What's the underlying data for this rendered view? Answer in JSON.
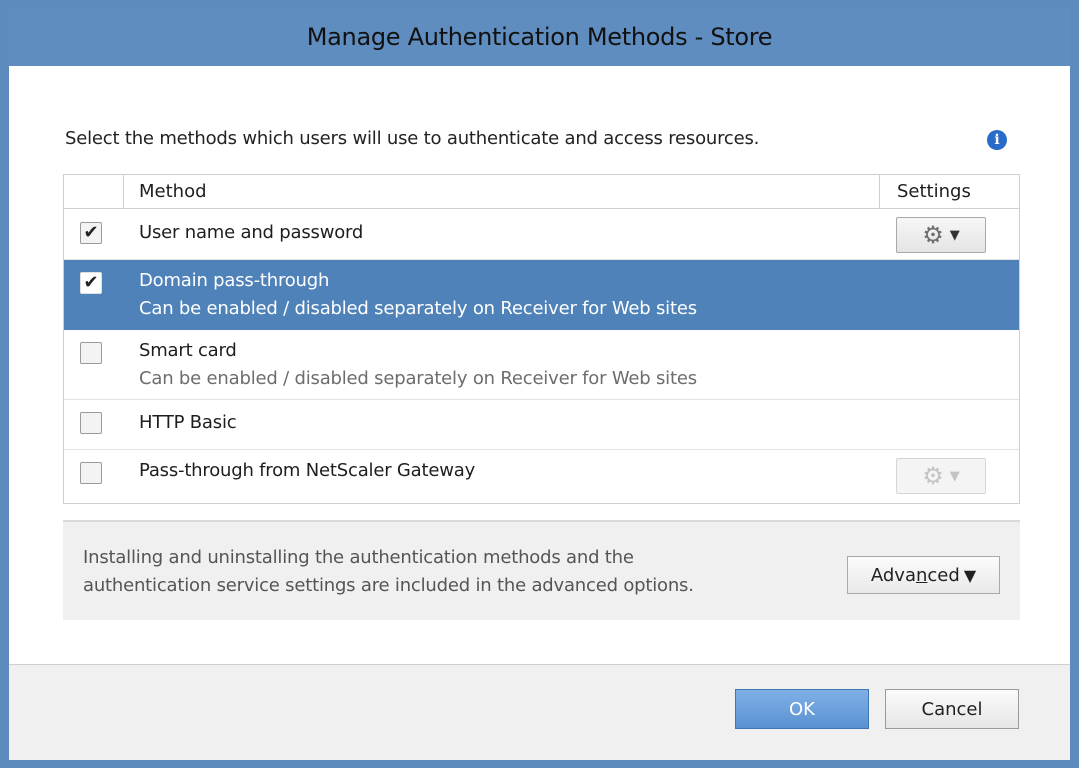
{
  "window": {
    "title": "Manage Authentication Methods - Store"
  },
  "instruction": "Select the methods which users will use to authenticate and access resources.",
  "grid": {
    "columns": {
      "method": "Method",
      "settings": "Settings"
    },
    "rows": [
      {
        "label": "User name and password",
        "sub": "",
        "checked": true,
        "selected": false,
        "gear": "enabled"
      },
      {
        "label": "Domain pass-through",
        "sub": "Can be enabled / disabled separately on Receiver for Web sites",
        "checked": true,
        "selected": true,
        "gear": "none"
      },
      {
        "label": "Smart card",
        "sub": "Can be enabled / disabled separately on Receiver for Web sites",
        "checked": false,
        "selected": false,
        "gear": "none"
      },
      {
        "label": "HTTP Basic",
        "sub": "",
        "checked": false,
        "selected": false,
        "gear": "none"
      },
      {
        "label": "Pass-through from NetScaler Gateway",
        "sub": "",
        "checked": false,
        "selected": false,
        "gear": "disabled"
      }
    ]
  },
  "advanced": {
    "line1": "Installing and uninstalling the authentication methods and the",
    "line2": "authentication service settings are included in the advanced options.",
    "button_pre": "Adva",
    "button_underlined": "n",
    "button_post": "ced"
  },
  "footer": {
    "ok_label": "OK",
    "cancel_label": "Cancel"
  },
  "colors": {
    "title_bar": "#5f8dbf",
    "selected_row": "#4f82b8",
    "info_icon": "#2a6ac9"
  },
  "icons": {
    "info": "info-icon",
    "check": "checkmark-icon",
    "gear": "gear-icon",
    "caret": "caret-down-icon"
  }
}
